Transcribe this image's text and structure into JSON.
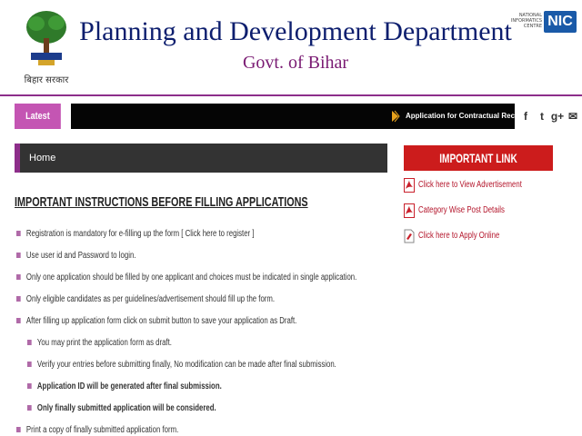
{
  "header": {
    "emblem_caption": "बिहार सरकार",
    "title": "Planning and Development Department",
    "subtitle": "Govt. of Bihar",
    "nic_text": "NATIONAL INFORMATICS CENTRE",
    "nic_mark": "NIC"
  },
  "news": {
    "tab_label": "Latest News",
    "ticker_text": "Application for Contractual Recruitm"
  },
  "social": {
    "facebook": "f",
    "twitter": "t",
    "googleplus": "g+",
    "email": "✉"
  },
  "breadcrumb": {
    "label": "Home"
  },
  "instructions": {
    "title": "IMPORTANT INSTRUCTIONS BEFORE FILLING APPLICATIONS",
    "items": [
      "Registration is mandatory for e-filling up the form [ Click here to register ]",
      "Use user id and Password to login.",
      "Only one application should be filled by one applicant and choices must be indicated in single application.",
      "Only eligible candidates as per guidelines/advertisement should fill up the form.",
      "After filling up application form click on submit button to save your application as Draft.",
      "You may print the application form as draft.",
      "Verify your entries before submitting finally, No modification can be made after final submission.",
      "Application ID will be generated after final submission.",
      "Only finally submitted application will be considered.",
      "Print a copy of finally submitted application form."
    ]
  },
  "important_links": {
    "header": "IMPORTANT LINK",
    "links": [
      "Click here to View Advertisement",
      "Category Wise Post Details",
      "Click here to Apply Online"
    ]
  },
  "colors": {
    "title_blue": "#0d1e6e",
    "subtitle_purple": "#7a1b73",
    "accent_purple": "#8d2e8a",
    "link_red": "#b3142a",
    "panel_red": "#cc1c1c"
  }
}
